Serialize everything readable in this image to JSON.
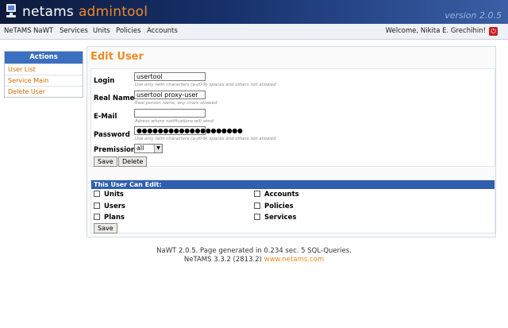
{
  "header": {
    "logo_part1": "netams",
    "logo_part2": "admintool",
    "version": "version 2.0.5"
  },
  "nav": {
    "items": [
      "NeTAMS",
      "NaWT",
      "Services",
      "Units",
      "Policies",
      "Accounts"
    ],
    "welcome": "Welcome, Nikita E. Grechihin!"
  },
  "sidebar": {
    "title": "Actions",
    "items": [
      "User List",
      "Service Main",
      "Delete User"
    ]
  },
  "page": {
    "title": "Edit User"
  },
  "form": {
    "login_label": "Login",
    "login_value": "usertool",
    "login_hint": "Use only latin characters (a-z0-9) spaces and others not allowed",
    "realname_label": "Real Name",
    "realname_value": "usertool proxy-user",
    "realname_hint": "Real person name, any chars allowed",
    "email_label": "E-Mail",
    "email_value": "",
    "email_hint": "Adress where notifications will send",
    "password_label": "Password",
    "password_value": "●●●●●●●●●●●●●●●●●●●●",
    "password_hint": "Use only latin characters (a-z0-9) spaces and others not allowed",
    "permission_label": "Premission",
    "permission_value": "all",
    "save_label": "Save",
    "delete_label": "Delete"
  },
  "permissions": {
    "title": "This User Can Edit:",
    "left": [
      "Units",
      "Users",
      "Plans"
    ],
    "right": [
      "Accounts",
      "Policies",
      "Services"
    ],
    "save_label": "Save"
  },
  "footer": {
    "line1": "NaWT 2.0.5. Page generated in 0.234 sec. 5 SQL-Queries.",
    "line2_prefix": "NeTAMS 3.3.2 (2813.2)",
    "line2_link": "www.netams.com"
  },
  "colors": {
    "accent": "#f08a24",
    "header_blue": "#17316d",
    "panel_blue": "#3b6fbf"
  }
}
